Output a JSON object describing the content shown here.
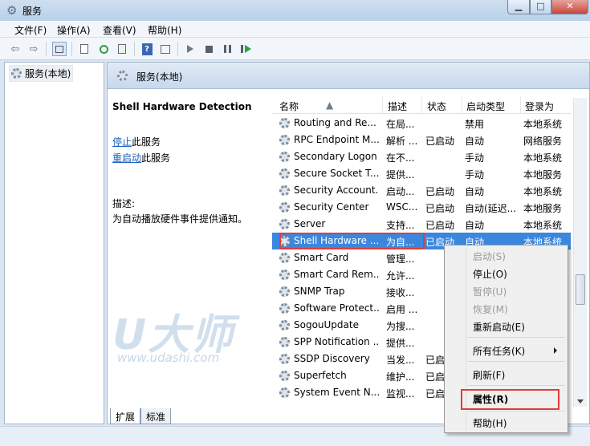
{
  "window": {
    "title": "服务",
    "min_glyph": "▁",
    "max_glyph": "□",
    "close_glyph": "✕"
  },
  "menu": [
    "文件(F)",
    "操作(A)",
    "查看(V)",
    "帮助(H)"
  ],
  "toolbar": {
    "back": "⇦",
    "forward": "⇨",
    "help": "?"
  },
  "tree": {
    "root_label": "服务(本地)"
  },
  "right": {
    "header": "服务(本地)",
    "detail": {
      "service_name": "Shell Hardware Detection",
      "stop_link": "停止",
      "stop_suffix": "此服务",
      "restart_link": "重启动",
      "restart_suffix": "此服务",
      "desc_label": "描述:",
      "desc_text": "为自动播放硬件事件提供通知。"
    },
    "columns": [
      "名称",
      "描述",
      "状态",
      "启动类型",
      "登录为"
    ],
    "rows": [
      {
        "name": "Routing and Re...",
        "desc": "在局...",
        "status": "",
        "startup": "禁用",
        "logon": "本地系统"
      },
      {
        "name": "RPC Endpoint M...",
        "desc": "解析 ...",
        "status": "已启动",
        "startup": "自动",
        "logon": "网络服务"
      },
      {
        "name": "Secondary Logon",
        "desc": "在不...",
        "status": "",
        "startup": "手动",
        "logon": "本地系统"
      },
      {
        "name": "Secure Socket T...",
        "desc": "提供...",
        "status": "",
        "startup": "手动",
        "logon": "本地服务"
      },
      {
        "name": "Security Account...",
        "desc": "启动...",
        "status": "已启动",
        "startup": "自动",
        "logon": "本地系统"
      },
      {
        "name": "Security Center",
        "desc": "WSC...",
        "status": "已启动",
        "startup": "自动(延迟...",
        "logon": "本地服务"
      },
      {
        "name": "Server",
        "desc": "支持...",
        "status": "已启动",
        "startup": "自动",
        "logon": "本地系统"
      },
      {
        "name": "Shell Hardware ...",
        "desc": "为自...",
        "status": "已启动",
        "startup": "自动",
        "logon": "本地系统"
      },
      {
        "name": "Smart Card",
        "desc": "管理...",
        "status": "",
        "startup": "",
        "logon": ""
      },
      {
        "name": "Smart Card Rem...",
        "desc": "允许...",
        "status": "",
        "startup": "",
        "logon": ""
      },
      {
        "name": "SNMP Trap",
        "desc": "接收...",
        "status": "",
        "startup": "",
        "logon": ""
      },
      {
        "name": "Software Protect...",
        "desc": "启用 ...",
        "status": "",
        "startup": "",
        "logon": ""
      },
      {
        "name": "SogouUpdate",
        "desc": "为搜...",
        "status": "",
        "startup": "",
        "logon": ""
      },
      {
        "name": "SPP Notification ...",
        "desc": "提供...",
        "status": "",
        "startup": "",
        "logon": ""
      },
      {
        "name": "SSDP Discovery",
        "desc": "当发...",
        "status": "已启",
        "startup": "",
        "logon": ""
      },
      {
        "name": "Superfetch",
        "desc": "维护...",
        "status": "已启",
        "startup": "",
        "logon": ""
      },
      {
        "name": "System Event N...",
        "desc": "监视...",
        "status": "已启",
        "startup": "",
        "logon": ""
      }
    ]
  },
  "tabs": [
    "扩展",
    "标准"
  ],
  "watermark": {
    "logo": "U大师",
    "url": "www.udashi.com"
  },
  "context_menu": {
    "start": "启动(S)",
    "stop": "停止(O)",
    "pause": "暂停(U)",
    "resume": "恢复(M)",
    "restart": "重新启动(E)",
    "all_tasks": "所有任务(K)",
    "refresh": "刷新(F)",
    "properties": "属性(R)",
    "help": "帮助(H)"
  }
}
